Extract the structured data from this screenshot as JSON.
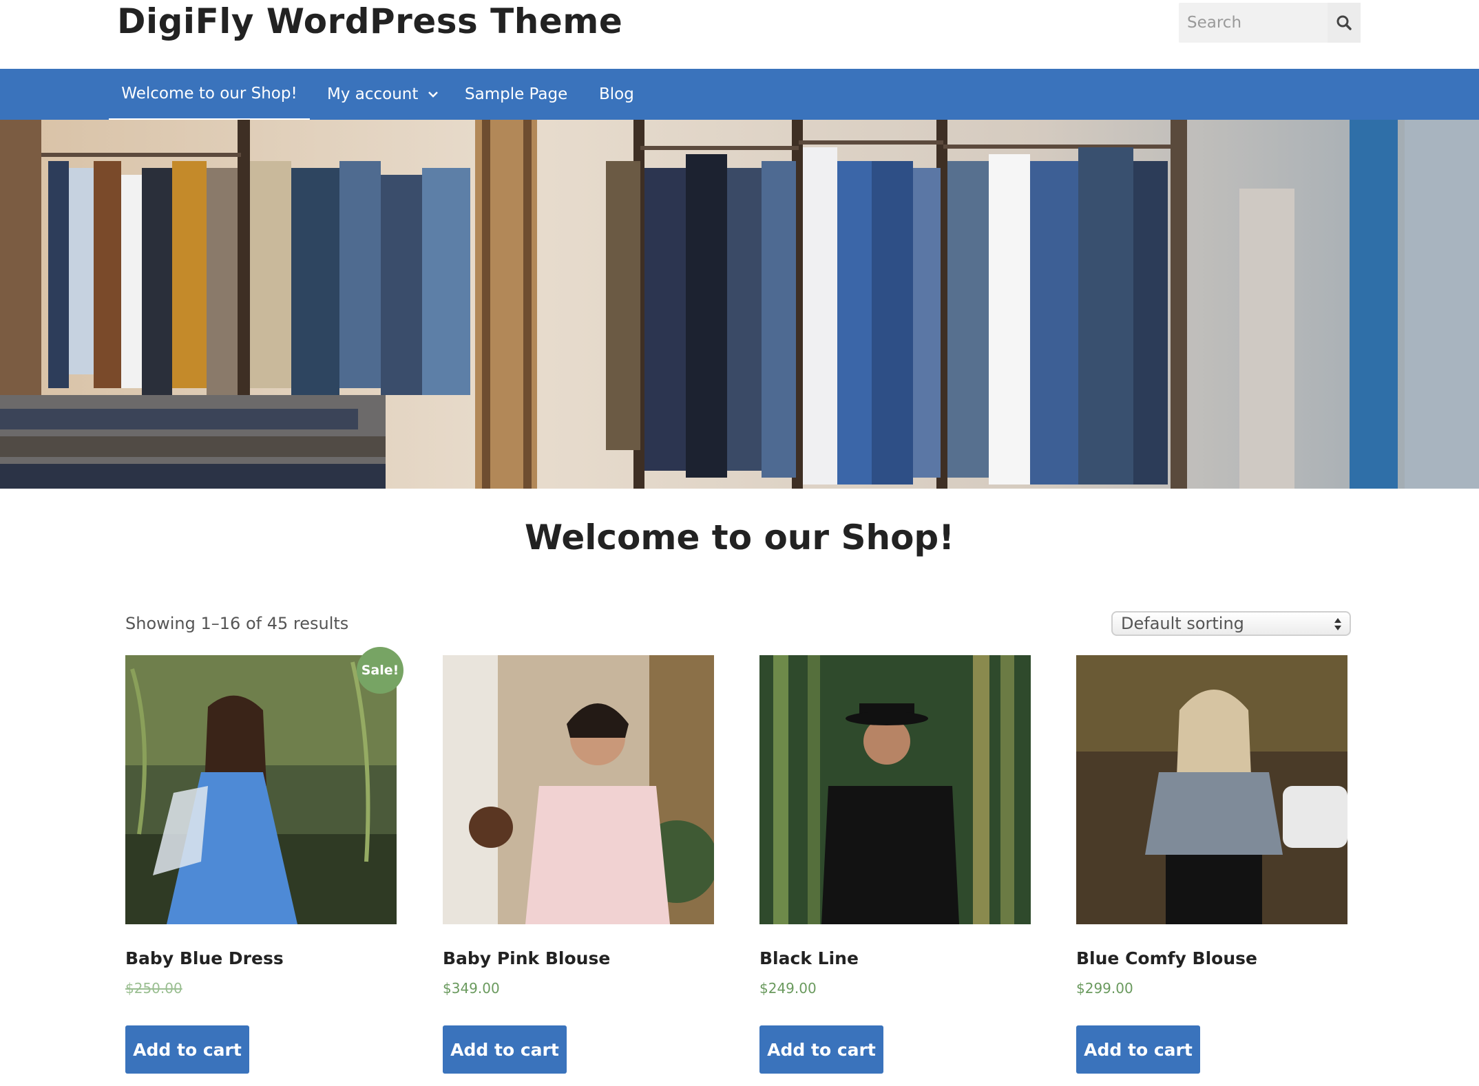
{
  "site": {
    "title": "DigiFly WordPress Theme"
  },
  "search": {
    "placeholder": "Search",
    "icon": "search-icon"
  },
  "nav": {
    "items": [
      {
        "label": "Welcome to our Shop!",
        "active": true
      },
      {
        "label": "My account",
        "has_dropdown": true
      },
      {
        "label": "Sample Page"
      },
      {
        "label": "Blog"
      }
    ]
  },
  "page": {
    "title": "Welcome to our Shop!",
    "result_count": "Showing 1–16 of 45 results",
    "sorting": {
      "selected": "Default sorting"
    }
  },
  "products": [
    {
      "name": "Baby Blue Dress",
      "price": "$250.00",
      "on_sale": true,
      "badge": "Sale!",
      "button": "Add to cart"
    },
    {
      "name": "Baby Pink Blouse",
      "price": "$349.00",
      "on_sale": false,
      "button": "Add to cart"
    },
    {
      "name": "Black Line",
      "price": "$249.00",
      "on_sale": false,
      "button": "Add to cart"
    },
    {
      "name": "Blue Comfy Blouse",
      "price": "$299.00",
      "on_sale": false,
      "button": "Add to cart"
    }
  ],
  "colors": {
    "nav": "#3a73bc",
    "button": "#3a73bc",
    "price": "#6a9a5e",
    "sale_badge": "#77a464"
  }
}
